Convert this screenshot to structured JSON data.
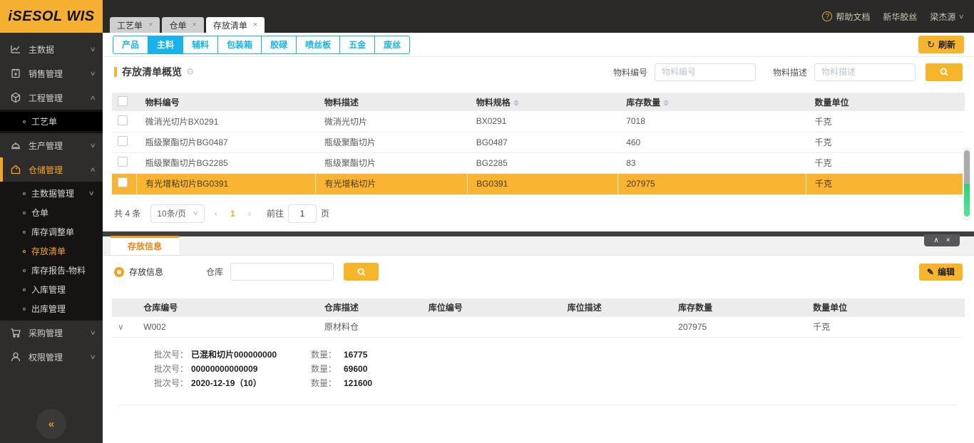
{
  "app": {
    "logo": "iSESOL WIS"
  },
  "icons": {
    "close": "×",
    "chevron_down": "∨",
    "chevron_up": "∧",
    "collapse_left": "«",
    "refresh": "↻",
    "edit": "✎",
    "gear": "⚙",
    "help": "?",
    "prev": "‹",
    "next": "›",
    "row_expand": "∨"
  },
  "topbar": {
    "window_tabs": [
      {
        "label": "工艺单"
      },
      {
        "label": "仓单"
      },
      {
        "label": "存放清单"
      }
    ],
    "help": "帮助文档",
    "company": "新华胶丝",
    "user": "梁杰源"
  },
  "sidebar": {
    "items": [
      {
        "label": "主数据"
      },
      {
        "label": "销售管理"
      },
      {
        "label": "工程管理",
        "children": [
          {
            "label": "工艺单"
          }
        ]
      },
      {
        "label": "生产管理"
      },
      {
        "label": "仓储管理",
        "children": [
          {
            "label": "主数据管理"
          },
          {
            "label": "仓单"
          },
          {
            "label": "库存调整单"
          },
          {
            "label": "存放清单"
          },
          {
            "label": "库存报告-物料"
          },
          {
            "label": "入库管理"
          },
          {
            "label": "出库管理"
          }
        ]
      },
      {
        "label": "采购管理"
      },
      {
        "label": "权限管理"
      }
    ]
  },
  "category_tabs": {
    "items": [
      {
        "label": "产品"
      },
      {
        "label": "主料"
      },
      {
        "label": "辅料"
      },
      {
        "label": "包装箱"
      },
      {
        "label": "胶碌"
      },
      {
        "label": "喷丝板"
      },
      {
        "label": "五金"
      },
      {
        "label": "废丝"
      }
    ],
    "active": "主料",
    "refresh_label": "刷新"
  },
  "overview": {
    "title": "存放清单概览",
    "filters": {
      "code_label": "物料编号",
      "code_placeholder": "物料编号",
      "desc_label": "物料描述",
      "desc_placeholder": "物料描述"
    },
    "table": {
      "columns": {
        "code": "物料编号",
        "desc": "物料描述",
        "spec": "物料规格",
        "qty": "库存数量",
        "unit": "数量单位"
      },
      "rows": [
        {
          "code": "微消光切片BX0291",
          "desc": "微消光切片",
          "spec": "BX0291",
          "qty": "7018",
          "unit": "千克"
        },
        {
          "code": "瓶级聚酯切片BG0487",
          "desc": "瓶级聚酯切片",
          "spec": "BG0487",
          "qty": "460",
          "unit": "千克"
        },
        {
          "code": "瓶级聚酯切片BG2285",
          "desc": "瓶级聚酯切片",
          "spec": "BG2285",
          "qty": "83",
          "unit": "千克"
        },
        {
          "code": "有光增粘切片BG0391",
          "desc": "有光增粘切片",
          "spec": "BG0391",
          "qty": "207975",
          "unit": "千克"
        }
      ]
    },
    "pagination": {
      "total": "共 4 条",
      "page_size": "10条/页",
      "current": "1",
      "goto_label": "前往",
      "goto_value": "1",
      "page_label": "页"
    }
  },
  "detail": {
    "tab_label": "存放信息",
    "radio_label": "存放信息",
    "warehouse_label": "仓库",
    "edit_label": "编辑",
    "table": {
      "columns": {
        "wh_code": "仓库编号",
        "wh_desc": "仓库描述",
        "loc_code": "库位编号",
        "loc_desc": "库位描述",
        "qty": "库存数量",
        "unit": "数量单位"
      },
      "rows": [
        {
          "wh_code": "W002",
          "wh_desc": "原材料仓",
          "loc_code": "",
          "loc_desc": "",
          "qty": "207975",
          "unit": "千克"
        }
      ]
    },
    "batches": {
      "batch_label": "批次号：",
      "qty_label": "数量：",
      "items": [
        {
          "batch": "已混和切片000000000",
          "qty": "16775"
        },
        {
          "batch": "00000000000009",
          "qty": "69600"
        },
        {
          "batch": "2020-12-19（10）",
          "qty": "121600"
        }
      ]
    }
  },
  "colors": {
    "accent_yellow": "#f7b52c",
    "selected_row": "#f9b431",
    "cyan": "#18b4e9",
    "detail_orange": "#f59a23",
    "sidebar_bg": "#2e2d2c",
    "topbar_bg": "#2b2a29",
    "scroll_green": "#2ecf77"
  }
}
